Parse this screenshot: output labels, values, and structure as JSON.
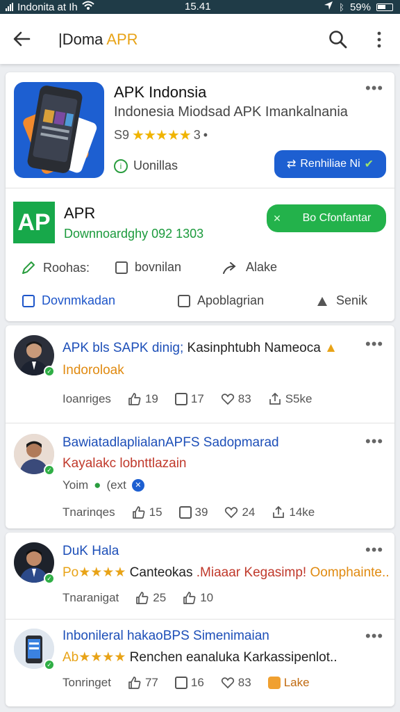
{
  "status_bar": {
    "carrier": "Indonita at Ih",
    "time": "15.41",
    "battery": "59%"
  },
  "app_bar": {
    "title_prefix": "|Doma",
    "title_accent": "APR"
  },
  "app_card": {
    "name": "APK Indonsia",
    "subtitle": "Indonesia  Miodsad APK Imankalnania",
    "rating_prefix": "S9",
    "stars": "★★★★★",
    "rating_suffix": "3",
    "rating_dot": "•",
    "verified_label": "Uonillas",
    "install_button": "Renhiliae Ni",
    "apr_logo": "AP",
    "apr_name": "APR",
    "apr_downloads": "Downnoardghy 092 1303",
    "download_button": "Bo Cfonfantar",
    "actions": [
      "Roohas:",
      "bovnilan",
      "Alake"
    ],
    "actions2": [
      "Dovnmkadan",
      "Apoblagrian",
      "Senik"
    ]
  },
  "posts": [
    {
      "title": "APK bls SAPK dinig;",
      "title_rest": " Kasinphtubh Nameoca",
      "subtitle": "Indoroloak",
      "subtitle_color": "#e08a10",
      "label": "Ioanriges",
      "likes": "19",
      "comments": "17",
      "hearts": "83",
      "shares": "S5ke"
    },
    {
      "title": "BawiatadlaplialanAPFS Sadopmarad",
      "title_rest": "",
      "subtitle": "Kayalakc lobnttlazain",
      "subtitle_color": "#c0392b",
      "inline_text": "Yoim",
      "inline_text2": "(ext",
      "label": "Tnarinqes",
      "likes": "15",
      "comments": "39",
      "hearts": "24",
      "shares": "14ke"
    },
    {
      "title": "DuK Hala",
      "title_rest": "",
      "sub_prefix": "Po★★★★",
      "subtitle": "Canteokas",
      "subtitle_red": ".Miaaar Kegasimp!",
      "subtitle_orange": "Oomphainte...",
      "label": "Tnaranigat",
      "likes": "25",
      "comments": "10"
    },
    {
      "title": "Inbonileral hakaoBPS Simenimaian",
      "title_rest": "",
      "sub_prefix": "Ab★★★★",
      "subtitle": "Renchen eanaluka Karkassipenlot..",
      "label": "Tonringet",
      "likes": "77",
      "comments": "16",
      "hearts": "83",
      "shares": "Lake"
    }
  ],
  "colors": {
    "primary_blue": "#1d5fd1",
    "green": "#23b24b",
    "status_bar": "#1f3b47"
  }
}
